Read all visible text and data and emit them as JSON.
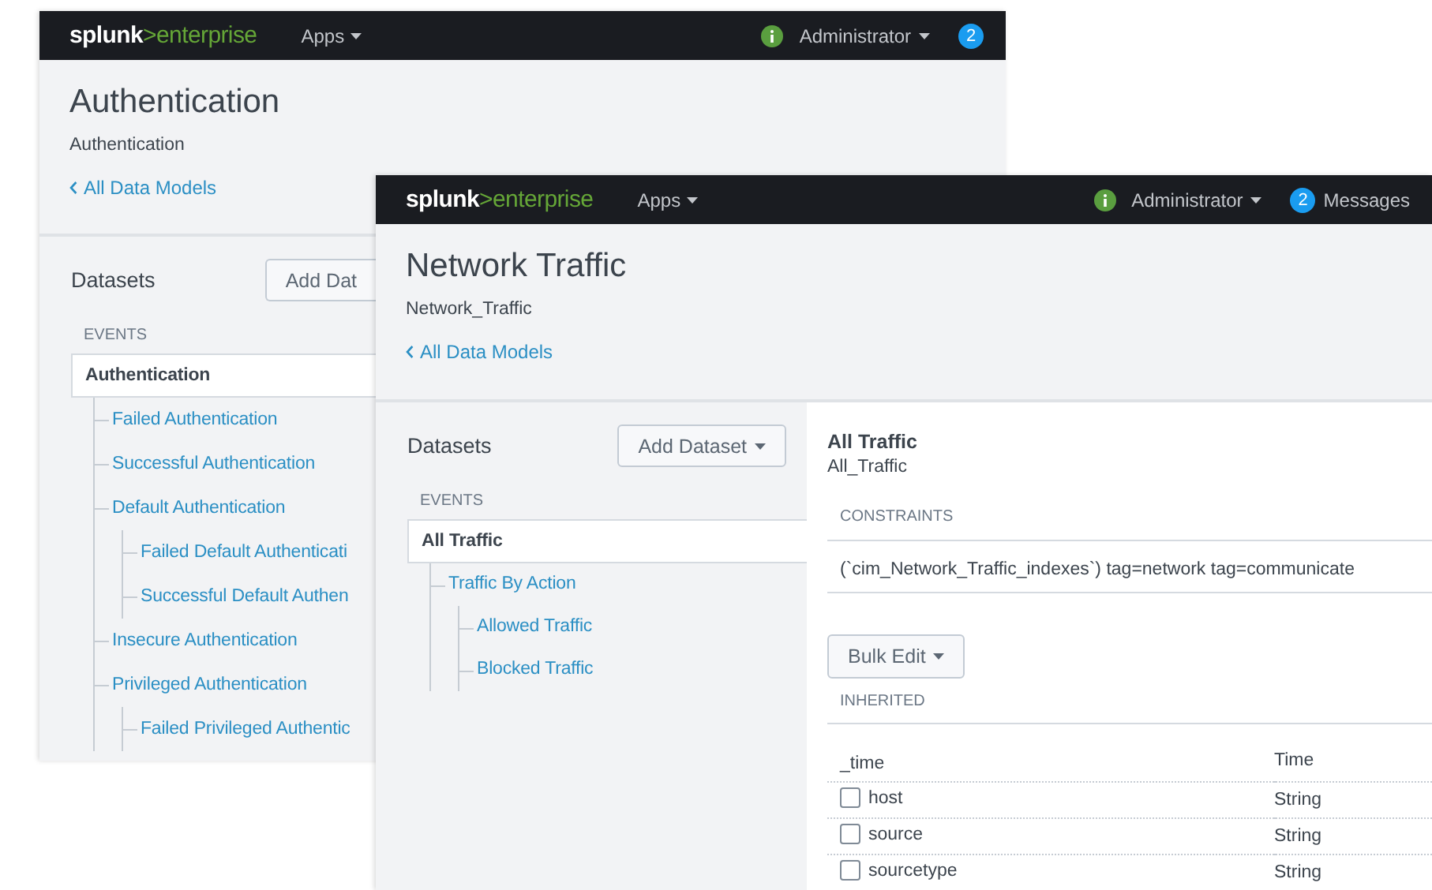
{
  "windows": [
    {
      "navbar": {
        "logo_brand": "splunk",
        "logo_product": ">enterprise",
        "apps": "Apps",
        "user": "Administrator",
        "messages_count": "2"
      },
      "header": {
        "title": "Authentication",
        "subtitle": "Authentication",
        "back_link": "All Data Models"
      },
      "datasets": {
        "heading": "Datasets",
        "add_button": "Add Dat",
        "add_caret": false,
        "section": "EVENTS",
        "items": [
          {
            "label": "Authentication",
            "selected": true,
            "children": [
              {
                "label": "Failed Authentication",
                "selected": false
              },
              {
                "label": "Successful Authentication",
                "selected": false
              },
              {
                "label": "Default Authentication",
                "selected": false,
                "children": [
                  {
                    "label": "Failed Default Authenticati",
                    "selected": false
                  },
                  {
                    "label": "Successful Default Authen",
                    "selected": false
                  }
                ]
              },
              {
                "label": "Insecure Authentication",
                "selected": false
              },
              {
                "label": "Privileged Authentication",
                "selected": false,
                "children": [
                  {
                    "label": "Failed Privileged Authentic",
                    "selected": false
                  }
                ]
              }
            ]
          }
        ]
      }
    },
    {
      "navbar": {
        "logo_brand": "splunk",
        "logo_product": ">enterprise",
        "apps": "Apps",
        "user": "Administrator",
        "messages_count": "2",
        "messages": "Messages"
      },
      "header": {
        "title": "Network Traffic",
        "subtitle": "Network_Traffic",
        "back_link": "All Data Models"
      },
      "datasets": {
        "heading": "Datasets",
        "add_button": "Add Dataset",
        "add_caret": true,
        "section": "EVENTS",
        "items": [
          {
            "label": "All Traffic",
            "selected": true,
            "children": [
              {
                "label": "Traffic By Action",
                "selected": false,
                "children": [
                  {
                    "label": "Allowed Traffic",
                    "selected": false
                  },
                  {
                    "label": "Blocked Traffic",
                    "selected": false
                  }
                ]
              }
            ]
          }
        ]
      },
      "detail": {
        "name": "All Traffic",
        "id": "All_Traffic",
        "constraints_heading": "CONSTRAINTS",
        "constraint": "(`cim_Network_Traffic_indexes`) tag=network tag=communicate",
        "bulk_edit": "Bulk Edit",
        "inherited_heading": "INHERITED",
        "fields": [
          {
            "kind": "fixed",
            "name": "_time",
            "type": "Time"
          },
          {
            "kind": "field",
            "name": "host",
            "type": "String",
            "checked": false
          },
          {
            "kind": "field",
            "name": "source",
            "type": "String",
            "checked": false
          },
          {
            "kind": "field",
            "name": "sourcetype",
            "type": "String",
            "checked": false
          }
        ]
      }
    }
  ]
}
